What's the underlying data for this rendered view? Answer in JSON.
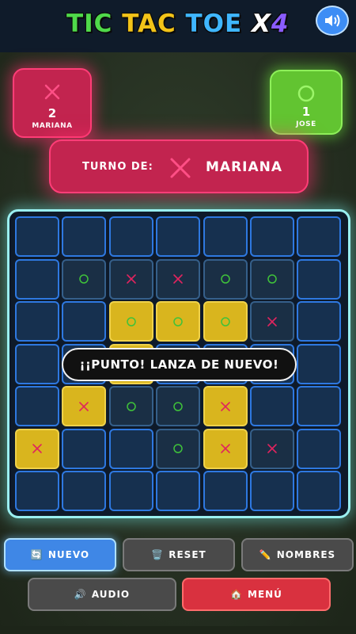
{
  "header": {
    "title_parts": [
      "TIC",
      "TAC",
      "TOE",
      "X",
      "4"
    ],
    "sound_icon": "speaker-icon"
  },
  "players": [
    {
      "name": "MARIANA",
      "score": "2",
      "symbol": "X",
      "color": "#c2244f"
    },
    {
      "name": "JOSE",
      "score": "1",
      "symbol": "O",
      "color": "#62c431"
    }
  ],
  "turn": {
    "label": "TURNO DE:",
    "symbol": "X",
    "name": "MARIANA"
  },
  "board": {
    "rows": 7,
    "cols": 7,
    "cells": [
      [
        "",
        "",
        "",
        "",
        "",
        "",
        ""
      ],
      [
        "",
        "O",
        "X",
        "X",
        "O",
        "O",
        ""
      ],
      [
        "",
        "",
        "O",
        "O",
        "O",
        "X",
        ""
      ],
      [
        "",
        "",
        "",
        "",
        "",
        "",
        ""
      ],
      [
        "",
        "X",
        "O",
        "O",
        "X",
        "",
        ""
      ],
      [
        "X",
        "",
        "",
        "O",
        "X",
        "X",
        ""
      ],
      [
        "",
        "",
        "",
        "",
        "",
        "",
        ""
      ]
    ],
    "highlighted": [
      [
        2,
        2
      ],
      [
        2,
        3
      ],
      [
        2,
        4
      ],
      [
        3,
        2
      ],
      [
        4,
        1
      ],
      [
        4,
        4
      ],
      [
        5,
        0
      ],
      [
        5,
        4
      ]
    ],
    "dimmed": [
      [
        1,
        1
      ],
      [
        1,
        2
      ],
      [
        1,
        3
      ],
      [
        1,
        4
      ],
      [
        1,
        5
      ],
      [
        2,
        5
      ],
      [
        4,
        2
      ],
      [
        4,
        3
      ],
      [
        5,
        3
      ],
      [
        5,
        5
      ]
    ]
  },
  "banner": {
    "text": "¡¡PUNTO! LANZA DE NUEVO!"
  },
  "buttons": {
    "nuevo": "NUEVO",
    "reset": "RESET",
    "nombres": "NOMBRES",
    "audio": "AUDIO",
    "menu": "MENÚ"
  },
  "colors": {
    "x_mark": "#e0245e",
    "o_mark": "#3fc23a",
    "highlight": "#d9b51e",
    "cell_border": "#2e78e0"
  }
}
